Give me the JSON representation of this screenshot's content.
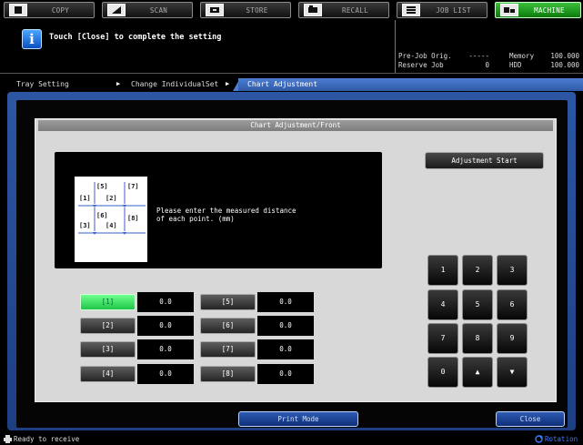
{
  "tabs": [
    {
      "label": "COPY",
      "icon": "copy-icon"
    },
    {
      "label": "SCAN",
      "icon": "scan-icon"
    },
    {
      "label": "STORE",
      "icon": "store-icon"
    },
    {
      "label": "RECALL",
      "icon": "recall-icon"
    },
    {
      "label": "JOB LIST",
      "icon": "job-list-icon"
    },
    {
      "label": "MACHINE",
      "icon": "machine-icon",
      "active": true
    }
  ],
  "message": {
    "text": "Touch [Close] to complete the setting",
    "icon": "info-icon",
    "icon_char": "i"
  },
  "status": {
    "prejob_label": "Pre-Job Orig.",
    "prejob_value": "-----",
    "reserve_label": "Reserve Job",
    "reserve_value": "0",
    "memory_label": "Memory",
    "memory_value": "100.000",
    "hdd_label": "HDD",
    "hdd_value": "100.000"
  },
  "breadcrumb": {
    "items": [
      "Tray Setting",
      "Change IndividualSet"
    ],
    "current": "Chart Adjustment"
  },
  "panel": {
    "title": "Chart Adjustment/Front",
    "instruction_line1": "Please enter the measured distance",
    "instruction_line2": "of each point. (mm)",
    "diagram_labels": [
      "[5]",
      "[7]",
      "[1]",
      "[2]",
      "[6]",
      "[8]",
      "[3]",
      "[4]"
    ]
  },
  "adjustment_start_label": "Adjustment Start",
  "points": [
    {
      "label": "[1]",
      "value": "0.0",
      "selected": true
    },
    {
      "label": "[2]",
      "value": "0.0"
    },
    {
      "label": "[3]",
      "value": "0.0"
    },
    {
      "label": "[4]",
      "value": "0.0"
    },
    {
      "label": "[5]",
      "value": "0.0"
    },
    {
      "label": "[6]",
      "value": "0.0"
    },
    {
      "label": "[7]",
      "value": "0.0"
    },
    {
      "label": "[8]",
      "value": "0.0"
    }
  ],
  "keypad": {
    "keys": [
      "1",
      "2",
      "3",
      "4",
      "5",
      "6",
      "7",
      "8",
      "9",
      "0",
      "▲",
      "▼"
    ]
  },
  "bottom": {
    "print_mode_label": "Print Mode",
    "close_label": "Close"
  },
  "statusbar": {
    "text": "Ready to receive",
    "rotation_label": "Rotation"
  },
  "colors": {
    "frame_blue": "#2c56a3",
    "machine_green": "#22a822",
    "selected_green": "#3ee563",
    "rotation_blue": "#3e7bff"
  }
}
